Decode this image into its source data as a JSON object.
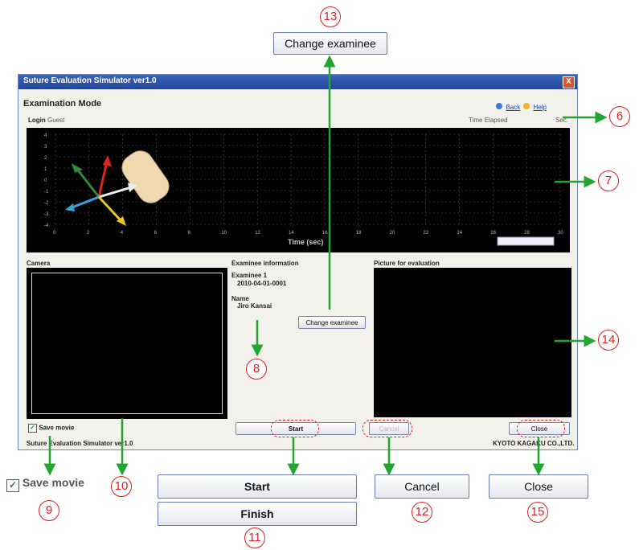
{
  "window": {
    "title": "Suture Evaluation Simulator ver1.0",
    "close_glyph": "X",
    "mode": "Examination Mode",
    "back_label": "Back",
    "help_label": "Help",
    "login_label": "Login",
    "login_value": "Guest",
    "time_elapsed_label": "Time Elapsed",
    "sec_label": "Sec.",
    "graph_xlabel": "Time (sec)",
    "graph_yticks": [
      "4",
      "3",
      "2",
      "1",
      "0",
      "-1",
      "-2",
      "-3",
      "-4"
    ],
    "graph_xticks": [
      "0",
      "2",
      "4",
      "6",
      "8",
      "10",
      "12",
      "14",
      "16",
      "18",
      "20",
      "22",
      "24",
      "26",
      "28",
      "30"
    ],
    "camera_label": "Camera",
    "examinee_info_label": "Examinee information",
    "examinee_label": "Examinee 1",
    "examinee_id": "2010-04-01-0001",
    "name_label": "Name",
    "name_value": "Jiro Kansai",
    "change_examinee_label": "Change examinee",
    "picture_label": "Picture for evaluation",
    "save_movie_label": "Save movie",
    "start_label": "Start",
    "cancel_label": "Cancel",
    "close_label": "Close",
    "footer_left": "Suture Evaluation Simulator ver1.0",
    "footer_right": "KYOTO KAGAKU CO.,LTD."
  },
  "callouts": {
    "change_examinee_label": "Change examinee",
    "save_movie_label": "Save movie",
    "start_label": "Start",
    "finish_label": "Finish",
    "cancel_label": "Cancel",
    "close_label": "Close",
    "n6": "6",
    "n7": "7",
    "n8": "8",
    "n9": "9",
    "n10": "10",
    "n11": "11",
    "n12": "12",
    "n13": "13",
    "n14": "14",
    "n15": "15"
  },
  "colors": {
    "annotation_arrow": "#22a531",
    "annotation_circle": "#e02020",
    "title_bar": "#2b4fa5"
  }
}
